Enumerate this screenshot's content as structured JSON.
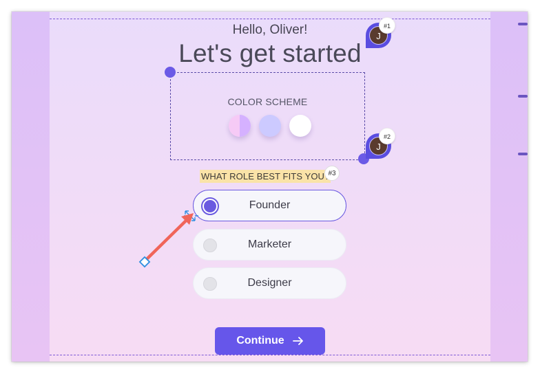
{
  "greeting": "Hello, Oliver!",
  "headline": "Let's get started",
  "color_scheme": {
    "label": "COLOR SCHEME",
    "swatches": [
      "#d9b6ff",
      "#cccaff",
      "#ffffff"
    ]
  },
  "avatars": [
    {
      "initial": "J",
      "badge": "#1"
    },
    {
      "initial": "J",
      "badge": "#2"
    }
  ],
  "question": {
    "label": "WHAT ROLE BEST FITS YOU?",
    "badge": "#3"
  },
  "roles": [
    {
      "label": "Founder",
      "selected": true
    },
    {
      "label": "Marketer",
      "selected": false
    },
    {
      "label": "Designer",
      "selected": false
    }
  ],
  "continue_button": {
    "label": "Continue",
    "icon": "arrow-right-icon"
  },
  "colors": {
    "accent": "#6656ea",
    "highlight": "#fae3a8",
    "annotation_arrow": "#f0655a"
  }
}
